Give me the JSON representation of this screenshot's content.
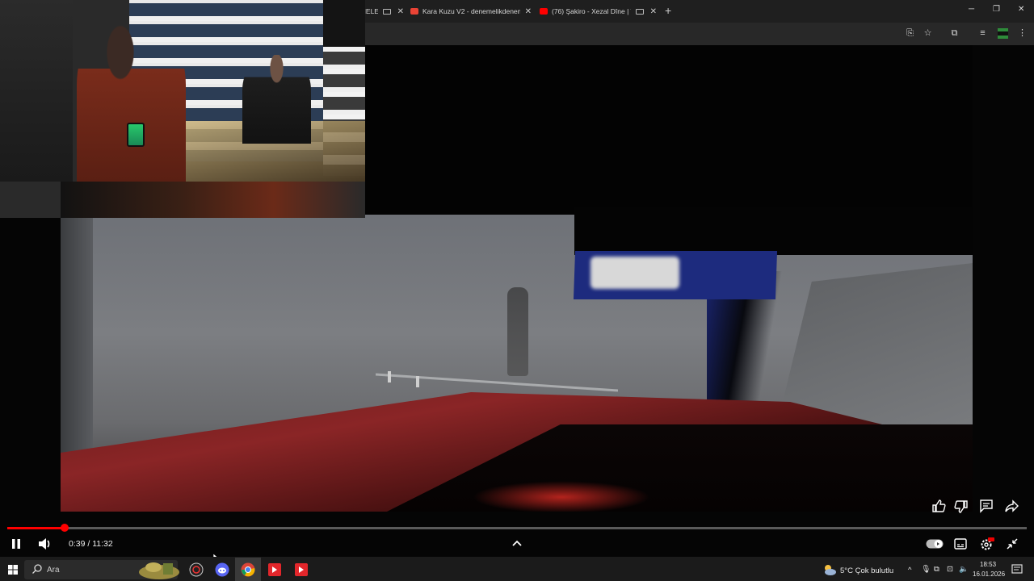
{
  "browser": {
    "tabs": [
      {
        "label": "FLİ KÖYDE NELER",
        "favicon_color": "#cc0000"
      },
      {
        "label": "Kara Kuzu V2 - denemelikdenem",
        "favicon_color": "#ea4335"
      },
      {
        "label": "(76) Şakiro - Xezal Dîne | Tü",
        "favicon_color": "#ff0000"
      }
    ],
    "accent": "#1f1f1f"
  },
  "player": {
    "current_time": "0:39",
    "time_separator": " / ",
    "duration": "11:32",
    "progress_fraction": 0.056,
    "progress_color": "#ff0000"
  },
  "taskbar": {
    "search_placeholder": "Ara",
    "weather": "5°C  Çok bulutlu",
    "clock_time": "18:53",
    "clock_date": "16.01.2026"
  }
}
